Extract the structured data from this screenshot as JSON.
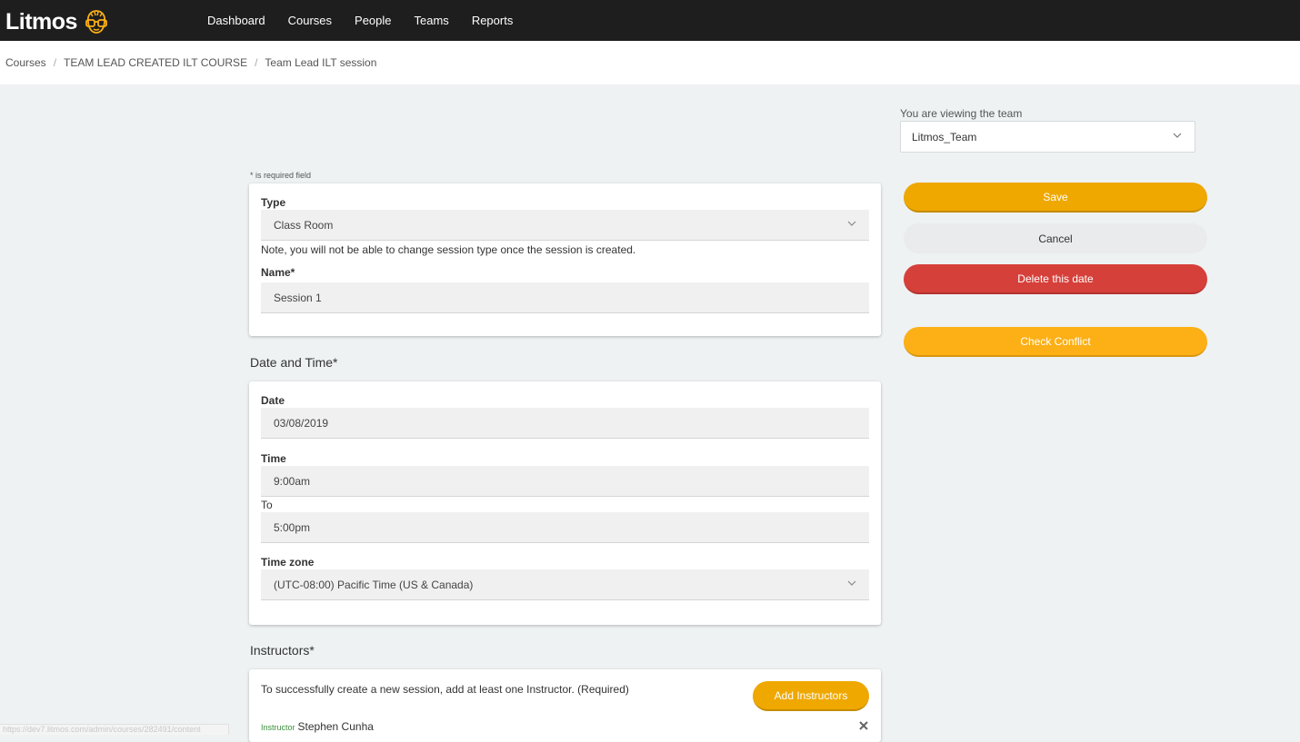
{
  "app": {
    "brand": "Litmos",
    "accent_color": "#efa800",
    "danger_color": "#d6403a",
    "icons": {
      "logo": "nerd-glasses-icon",
      "chevron": "chevron-down-icon",
      "remove": "close-icon"
    }
  },
  "nav": {
    "items": [
      "Dashboard",
      "Courses",
      "People",
      "Teams",
      "Reports"
    ]
  },
  "breadcrumb": {
    "items": [
      "Courses",
      "TEAM LEAD CREATED ILT COURSE"
    ],
    "separator": "/",
    "current": "Team Lead ILT session"
  },
  "team": {
    "label": "You are viewing the team",
    "selected": "Litmos_Team"
  },
  "actions": {
    "save": "Save",
    "cancel": "Cancel",
    "delete": "Delete this date",
    "check_conflict": "Check Conflict"
  },
  "form": {
    "required_note": "* is required field",
    "type": {
      "label": "Type",
      "value": "Class Room",
      "note": "Note, you will not be able to change session type once the session is created."
    },
    "name": {
      "label": "Name*",
      "value": "Session 1"
    }
  },
  "date_time": {
    "title": "Date and Time*",
    "date_label": "Date",
    "date_value": "03/08/2019",
    "time_label": "Time",
    "time_start": "9:00am",
    "to_label": "To",
    "time_end": "5:00pm",
    "timezone_label": "Time zone",
    "timezone_value": "(UTC-08:00) Pacific Time (US & Canada)"
  },
  "instructors": {
    "title": "Instructors*",
    "hint": "To successfully create a new session, add at least one Instructor. (Required)",
    "add_button": "Add Instructors",
    "list": [
      {
        "tag": "Instructor",
        "name": "Stephen Cunha"
      }
    ]
  },
  "status_bar": {
    "url": "https://dev7.litmos.com/admin/courses/282491/content"
  }
}
